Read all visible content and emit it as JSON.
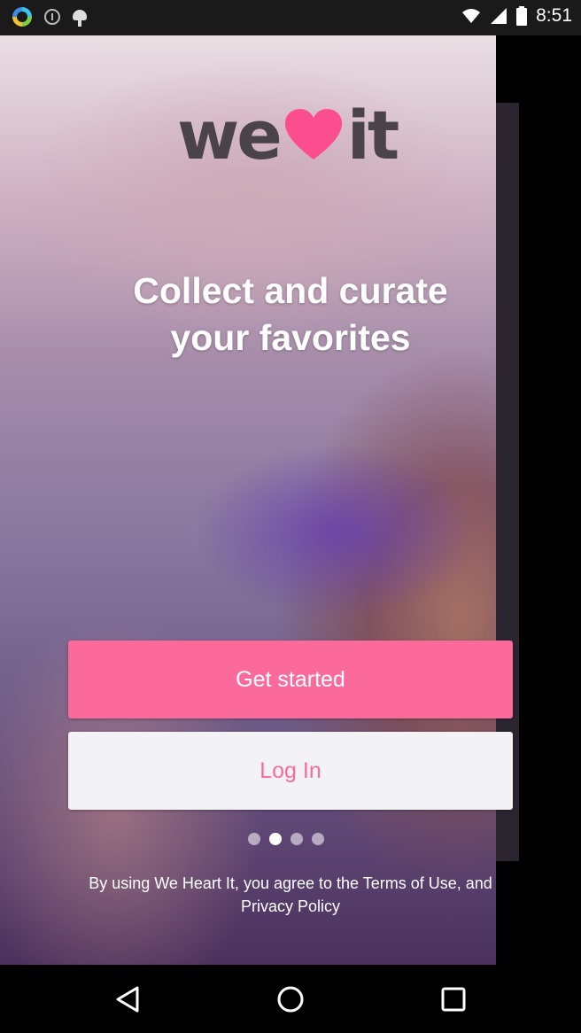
{
  "status_bar": {
    "time": "8:51",
    "icons": [
      "ring-app-icon",
      "info-icon",
      "android-icon"
    ],
    "right_icons": [
      "wifi-icon",
      "signal-icon",
      "battery-icon"
    ]
  },
  "logo": {
    "left": "we",
    "right": "it",
    "heart_color": "#fc4d8f"
  },
  "headline": "Collect and curate your favorites",
  "buttons": {
    "get_started": "Get started",
    "log_in": "Log In"
  },
  "pager": {
    "total": 4,
    "active_index": 1
  },
  "legal_text": "By using We Heart It, you agree to the Terms of Use, and Privacy Policy",
  "colors": {
    "accent": "#fc6a9c",
    "secondary_bg": "#f3f2f5"
  },
  "nav_bar": {
    "icons": [
      "back-icon",
      "home-icon",
      "recents-icon"
    ]
  }
}
